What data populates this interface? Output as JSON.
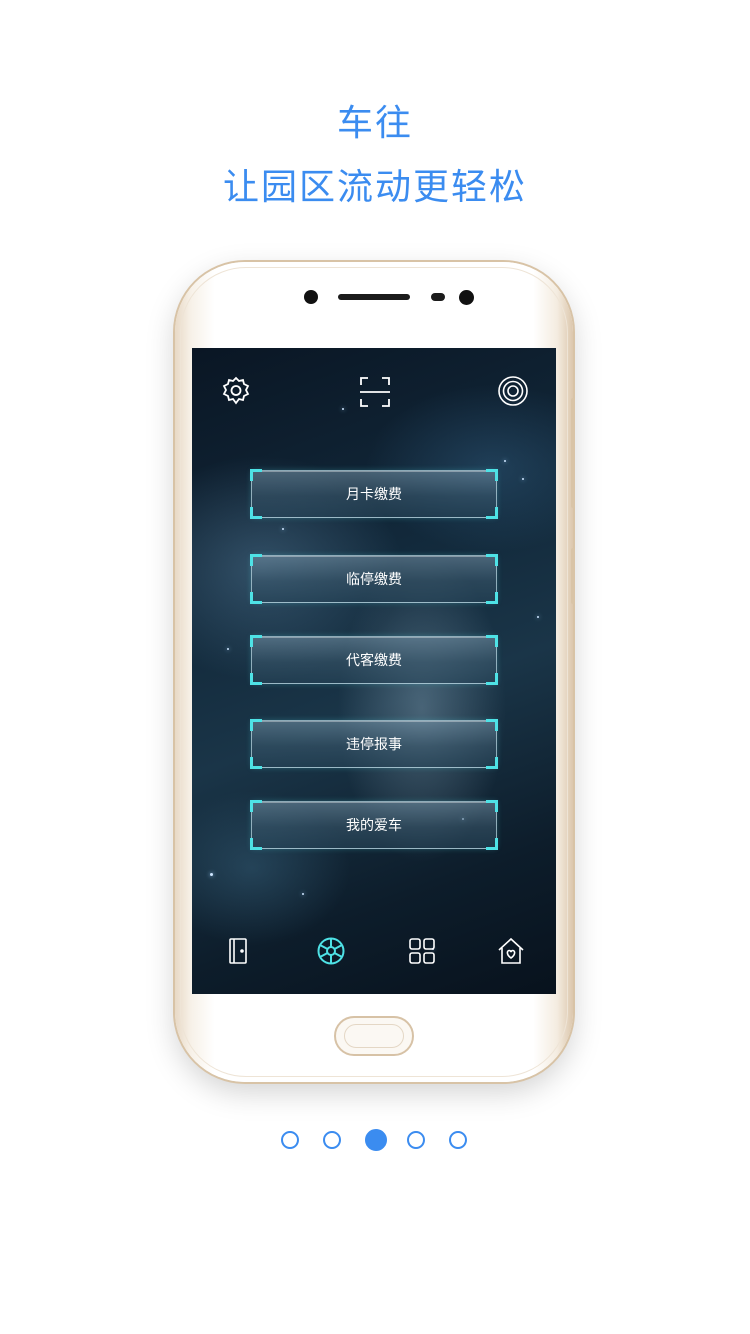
{
  "headline": {
    "line1": "车往",
    "line2": "让园区流动更轻松"
  },
  "accent_color": "#3b8cf0",
  "screen": {
    "top_icons": [
      "gear-icon",
      "scan-icon",
      "target-icon"
    ],
    "menu": [
      {
        "label": "月卡缴费"
      },
      {
        "label": "临停缴费"
      },
      {
        "label": "代客缴费"
      },
      {
        "label": "违停报事"
      },
      {
        "label": "我的爱车"
      }
    ],
    "bottom_nav": [
      {
        "icon": "door-icon",
        "active": false
      },
      {
        "icon": "wheel-icon",
        "active": true
      },
      {
        "icon": "grid-icon",
        "active": false
      },
      {
        "icon": "home-heart-icon",
        "active": false
      }
    ],
    "glow_color": "#4ee2e6"
  },
  "pager": {
    "count": 5,
    "active_index": 2
  }
}
